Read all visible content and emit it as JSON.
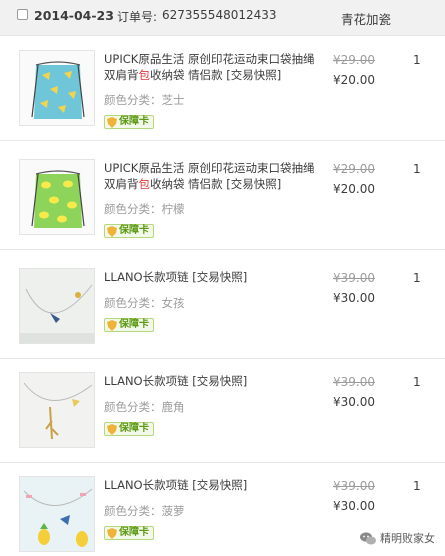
{
  "order": {
    "date": "2014-04-23",
    "order_no_label": "订单号:",
    "order_no": "627355548012433",
    "shop": "青花加瓷"
  },
  "items": [
    {
      "title_parts": [
        "UPICK原品生活 原创印花运动束口袋抽绳双肩背",
        "包",
        "收纳袋 情侣款 [交易快照]"
      ],
      "variant_label": "颜色分类：",
      "variant": "芝士",
      "badge": "保障卡",
      "old_price": "¥29.00",
      "price": "¥20.00",
      "qty": "1",
      "image": "drawstring-bag-cheese-icon"
    },
    {
      "title_parts": [
        "UPICK原品生活 原创印花运动束口袋抽绳双肩背",
        "包",
        "收纳袋 情侣款 [交易快照]"
      ],
      "variant_label": "颜色分类：",
      "variant": "柠檬",
      "badge": "保障卡",
      "old_price": "¥29.00",
      "price": "¥20.00",
      "qty": "1",
      "image": "drawstring-bag-lemon-icon"
    },
    {
      "title_parts": [
        "LLANO长款项链 [交易快照]",
        "",
        ""
      ],
      "variant_label": "颜色分类：",
      "variant": "女孩",
      "badge": "保障卡",
      "old_price": "¥39.00",
      "price": "¥30.00",
      "qty": "1",
      "image": "necklace-girl-icon"
    },
    {
      "title_parts": [
        "LLANO长款项链 [交易快照]",
        "",
        ""
      ],
      "variant_label": "颜色分类：",
      "variant": "鹿角",
      "badge": "保障卡",
      "old_price": "¥39.00",
      "price": "¥30.00",
      "qty": "1",
      "image": "necklace-antler-icon"
    },
    {
      "title_parts": [
        "LLANO长款项链 [交易快照]",
        "",
        ""
      ],
      "variant_label": "颜色分类：",
      "variant": "菠萝",
      "badge": "保障卡",
      "old_price": "¥39.00",
      "price": "¥30.00",
      "qty": "1",
      "image": "necklace-pineapple-icon"
    }
  ],
  "watermark": "精明败家女",
  "colors": {
    "header_bg": "#f1f1f1",
    "highlight": "#e4393c",
    "badge_green": "#5d9a16",
    "muted": "#9c9c9c"
  }
}
